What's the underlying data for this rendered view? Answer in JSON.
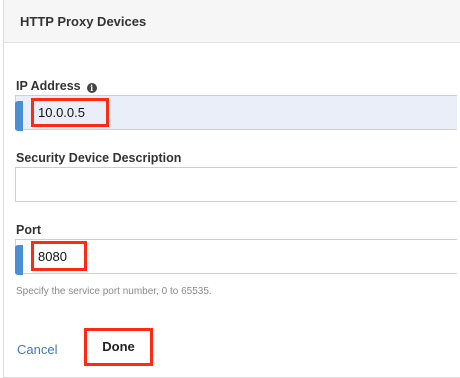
{
  "header": {
    "title": "HTTP Proxy Devices"
  },
  "form": {
    "ip_address": {
      "label": "IP Address",
      "info_icon": "info-icon",
      "value": "10.0.0.5"
    },
    "security_description": {
      "label": "Security Device Description",
      "value": ""
    },
    "port": {
      "label": "Port",
      "value": "8080",
      "help": "Specify the service port number, 0 to 65535."
    }
  },
  "actions": {
    "cancel_label": "Cancel",
    "done_label": "Done"
  },
  "colors": {
    "accent": "#4a8fd6",
    "link": "#3d7ac4",
    "highlight": "#ff2a12",
    "focused_field": "#e9eef9"
  }
}
